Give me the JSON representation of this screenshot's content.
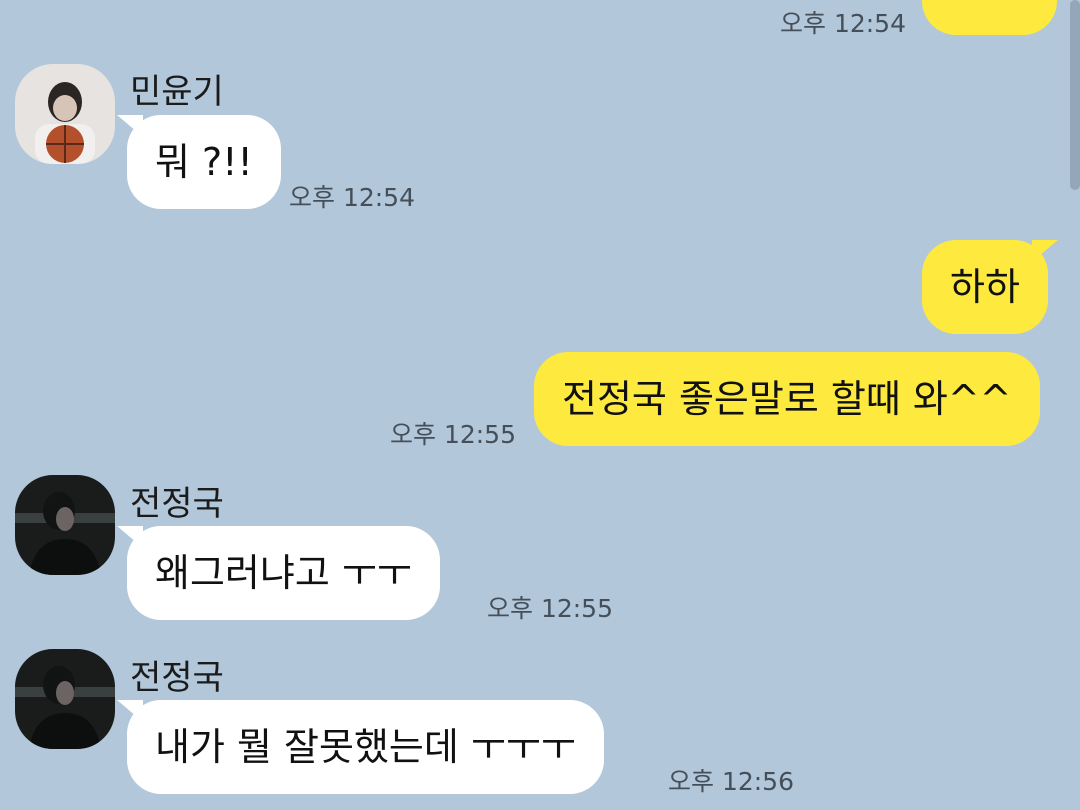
{
  "colors": {
    "background": "#b2c7da",
    "outgoing_bubble": "#fee93f",
    "incoming_bubble": "#ffffff",
    "timestamp": "#444f5a"
  },
  "chat": {
    "top_partial": {
      "time": "오후 12:54"
    },
    "msg_1": {
      "sender": "민윤기",
      "avatar": "avatar-photo-basketball",
      "text": "뭐 ?!!",
      "time": "오후 12:54"
    },
    "msg_2": {
      "text": "하하"
    },
    "msg_3": {
      "text": "전정국 좋은말로 할때 와^^",
      "time": "오후 12:55"
    },
    "msg_4": {
      "sender": "전정국",
      "avatar": "avatar-photo-dark",
      "text": "왜그러냐고 ㅜㅜ",
      "time": "오후 12:55"
    },
    "msg_5": {
      "sender": "전정국",
      "avatar": "avatar-photo-dark",
      "text": "내가 뭘 잘못했는데 ㅜㅜㅜ",
      "time": "오후 12:56"
    }
  }
}
